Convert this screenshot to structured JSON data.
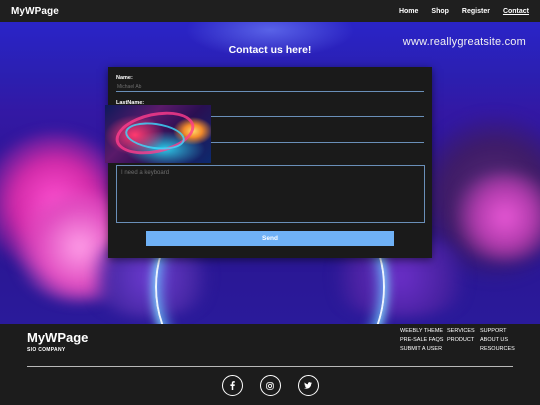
{
  "header": {
    "brand": "MyWPage",
    "nav": [
      "Home",
      "Shop",
      "Register",
      "Contact"
    ],
    "active_nav": "Contact"
  },
  "hero": {
    "title": "Contact us here!",
    "website": "www.reallygreatsite.com"
  },
  "form": {
    "name_label": "Name:",
    "name_placeholder": "Michael Ab",
    "lastname_label": "LastName:",
    "message_placeholder": "I need a keyboard",
    "send_label": "Send"
  },
  "footer": {
    "brand": "MyWPage",
    "company": "SIO COMPANY",
    "links": [
      "WEEBLY THEME",
      "SERVICES",
      "SUPPORT",
      "PRE-SALE FAQS",
      "PRODUCT",
      "ABOUT US",
      "SUBMIT A USER",
      "",
      "RESOURCES"
    ],
    "social_icons": [
      "facebook-icon",
      "instagram-icon",
      "twitter-icon"
    ]
  },
  "colors": {
    "accent": "#6fb1f6",
    "background": "#1c1c1c"
  }
}
